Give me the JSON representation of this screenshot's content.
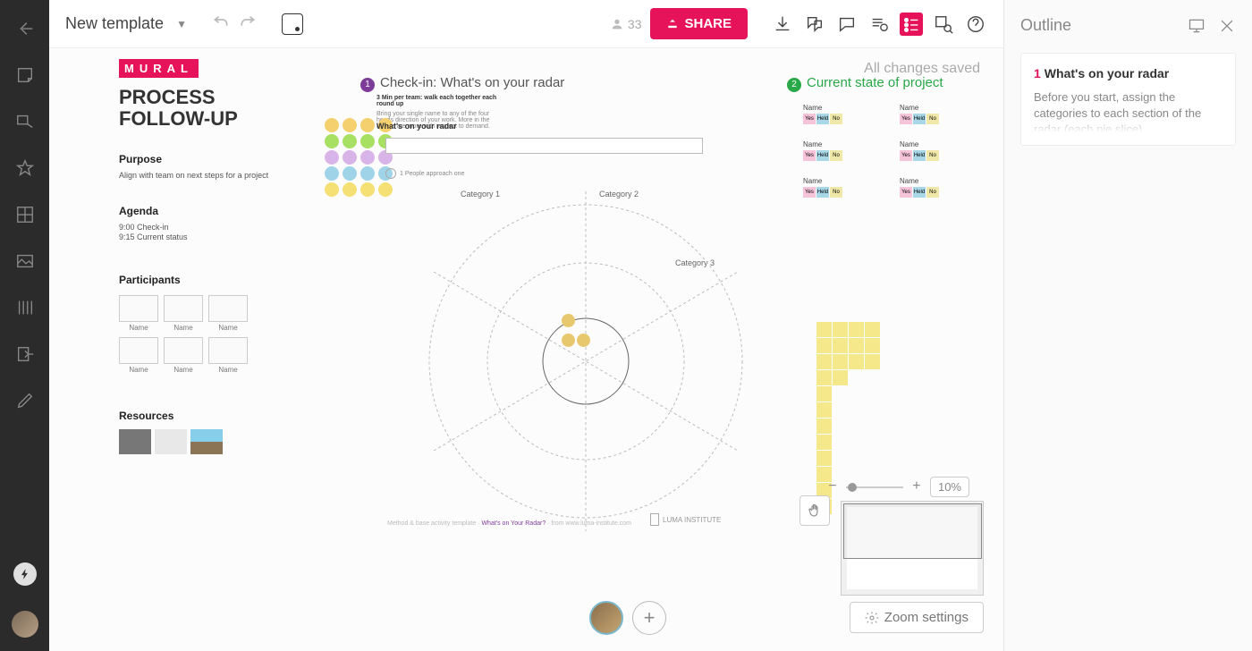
{
  "topbar": {
    "title": "New template",
    "member_count": "33",
    "share_label": "SHARE"
  },
  "status": "All changes saved",
  "panel": {
    "logo": "MURAL",
    "heading1": "PROCESS",
    "heading2": "FOLLOW-UP",
    "purpose_h": "Purpose",
    "purpose_t": "Align with team on next steps for a project",
    "agenda_h": "Agenda",
    "agenda_1": "9:00 Check-in",
    "agenda_2": "9:15 Current status",
    "participants_h": "Participants",
    "participant_label": "Name",
    "resources_h": "Resources"
  },
  "checkin": {
    "title": "Check-in: What's on your radar",
    "sub_bold": "3 Min per team: walk each together each round up",
    "sub_text": "Bring your single name to any of the four heads direction of your work. More in the middle are more with respect to demand.",
    "radar_label": "What's on your radar",
    "legend": "1 People approach one",
    "cat1": "Category 1",
    "cat2": "Category 2",
    "cat3": "Category 3",
    "luma": "LUMA INSTITUTE",
    "credit_pre": "Method & base activity template · ",
    "credit_em": "What's on Your Radar?",
    "credit_post": " · from www.luma-institute.com"
  },
  "state": {
    "title": "Current state of project",
    "name": "Name",
    "chip1": "Yes",
    "chip2": "Held",
    "chip3": "No"
  },
  "zoom": {
    "pct": "10%",
    "settings": "Zoom settings"
  },
  "outline": {
    "title": "Outline",
    "item_num": "1",
    "item_title": "What's on your radar",
    "item_body": "Before you start, assign the categories to each section of the radar (each pie slice)"
  }
}
